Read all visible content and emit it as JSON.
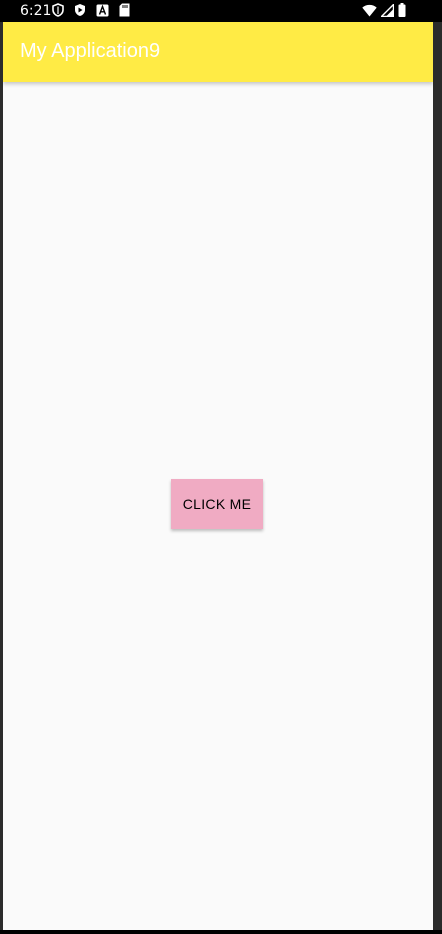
{
  "status_bar": {
    "time": "6:21",
    "left_icons": [
      "shield-outline-icon",
      "play-protect-icon",
      "a-box-icon",
      "sd-card-icon"
    ],
    "right_icons": [
      "wifi-icon",
      "cell-signal-icon",
      "battery-icon"
    ]
  },
  "app_bar": {
    "title": "My Application9"
  },
  "main": {
    "button_label": "CLICK ME"
  },
  "colors": {
    "app_bar": "#ffeb45",
    "title_text": "#ffffff",
    "background": "#fafafa",
    "button": "#f0abc3",
    "status_bar": "#000000"
  }
}
